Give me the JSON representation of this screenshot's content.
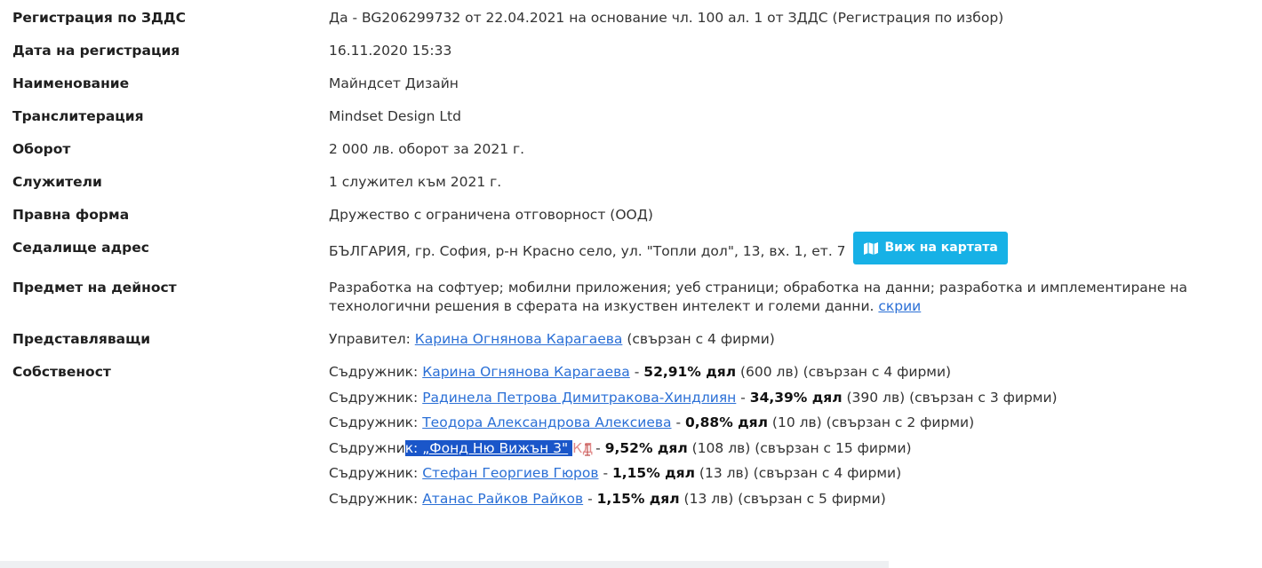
{
  "rows": {
    "vat": {
      "label": "Регистрация по ЗДДС",
      "value": "Да - BG206299732 от 22.04.2021 на основание чл. 100 ал. 1 от ЗДДС (Регистрация по избор)"
    },
    "reg_date": {
      "label": "Дата на регистрация",
      "value": "16.11.2020 15:33"
    },
    "name": {
      "label": "Наименование",
      "value": "Майндсет Дизайн"
    },
    "translit": {
      "label": "Транслитерация",
      "value": "Mindset Design Ltd"
    },
    "turnover": {
      "label": "Оборот",
      "value": "2 000 лв. оборот за 2021 г."
    },
    "employees": {
      "label": "Служители",
      "value": "1 служител към 2021 г."
    },
    "legal_form": {
      "label": "Правна форма",
      "value": "Дружество с ограничена отговорност (ООД)"
    },
    "address": {
      "label": "Седалище адрес",
      "value": "БЪЛГАРИЯ, гр. София, р-н Красно село, ул. \"Топли дол\", 13, вх. 1, ет. 7",
      "map_button": "Виж на картата"
    },
    "activity": {
      "label": "Предмет на дейност",
      "value": "Разработка на софтуер; мобилни приложения; уеб страници; обработка на данни; разработка и имплементиране на технологични решения в сферата на изкуствен интелект и големи данни.",
      "hide_link": "скрии"
    },
    "reps": {
      "label": "Представляващи",
      "role": "Управител:",
      "person": "Карина Огнянова Карагаева",
      "note": "(свързан с 4 фирми)"
    },
    "ownership": {
      "label": "Собственост",
      "owners": [
        {
          "role": "Съдружник:",
          "name": "Карина Огнянова Карагаева",
          "share": "52,91% дял",
          "amount": "(600 лв)",
          "note": "(свързан с 4 фирми)"
        },
        {
          "role": "Съдружник:",
          "name": "Радинела Петрова Димитракова-Хиндлиян",
          "share": "34,39% дял",
          "amount": "(390 лв)",
          "note": "(свързан с 3 фирми)"
        },
        {
          "role": "Съдружник:",
          "name": "Теодора Александрова Алексиева",
          "share": "0,88% дял",
          "amount": "(10 лв)",
          "note": "(свързан с 2 фирми)"
        },
        {
          "role_prefix": "Съдружни",
          "role_selected": "к:",
          "name": "„Фонд Ню Вижън 3\"",
          "name_suffix": "КД",
          "share": "9,52% дял",
          "amount": "(108 лв)",
          "note": "(свързан с 15 фирми)"
        },
        {
          "role": "Съдружник:",
          "name": "Стефан Георгиев Гюров",
          "share": "1,15% дял",
          "amount": "(13 лв)",
          "note": "(свързан с 4 фирми)"
        },
        {
          "role": "Съдружник:",
          "name": "Атанас Райков Райков",
          "share": "1,15% дял",
          "amount": "(13 лв)",
          "note": "(свързан с 5 фирми)"
        }
      ]
    }
  },
  "icons": {
    "map": "map-icon",
    "cursor": "text-cursor-icon"
  },
  "colors": {
    "link": "#2a6fd6",
    "button": "#17b1e6",
    "selection": "#1a56c9"
  },
  "separator": "-"
}
